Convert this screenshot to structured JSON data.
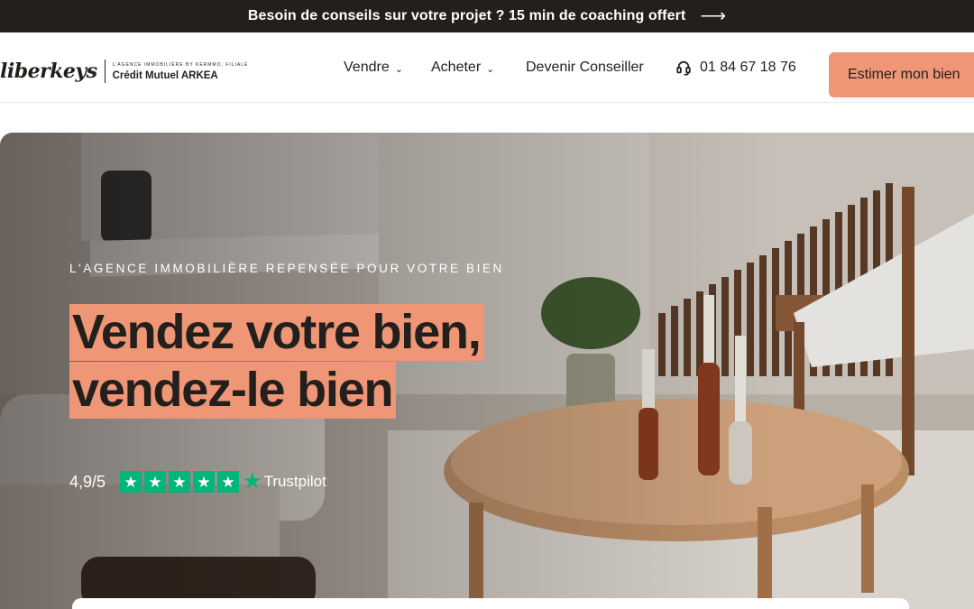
{
  "banner": {
    "text": "Besoin de conseils sur votre projet ? 15 min de coaching offert",
    "arrow_icon": "arrow-right-icon"
  },
  "header": {
    "logo": {
      "wordmark": "liberkeys",
      "tagline": "L'AGENCE IMMOBILIÈRE BY KERMMO, FILIALE",
      "bank": "Crédit Mutuel ARKEA"
    },
    "nav": {
      "sell": "Vendre",
      "buy": "Acheter",
      "advisor": "Devenir Conseiller",
      "phone": "01 84 67 18 76"
    },
    "cta": "Estimer mon bien"
  },
  "hero": {
    "eyebrow": "L'AGENCE IMMOBILIÈRE REPENSÉE POUR VOTRE BIEN",
    "headline_line1": "Vendez votre bien,",
    "headline_line2": "vendez-le bien",
    "rating": {
      "score": "4,9/5",
      "stars_filled": 5,
      "provider": "Trustpilot"
    }
  },
  "colors": {
    "brand_dark": "#231f1c",
    "accent_salmon": "#ee9675",
    "trustpilot_green": "#00b67a"
  }
}
